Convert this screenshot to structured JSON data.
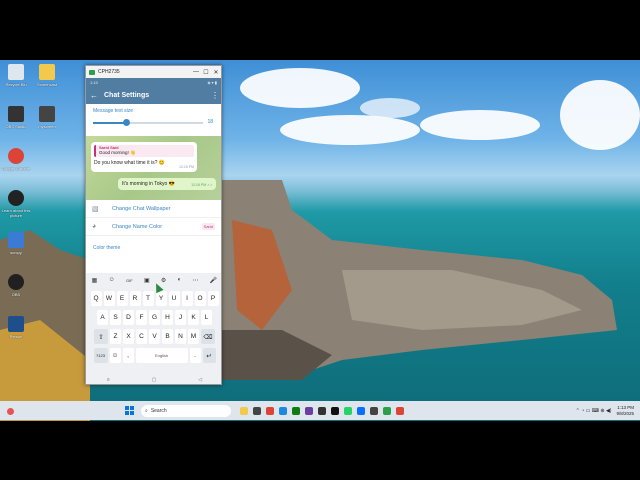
{
  "phone_window": {
    "title": "CPH2735",
    "min_label": "—",
    "max_label": "☐",
    "close_label": "✕"
  },
  "status_bar": {
    "time": "1:13",
    "right": "◈ ▾ ▮"
  },
  "app_bar": {
    "back_label": "←",
    "title": "Chat Settings",
    "menu_label": "⋮"
  },
  "message_size": {
    "label": "Message text size",
    "value": "18",
    "fraction": 0.3
  },
  "chat_preview": {
    "incoming": {
      "reply_name": "Sarid Said",
      "reply_text": "Good morning! 👋",
      "text": "Do you know what time it is? 😊",
      "time": "12:15 PM"
    },
    "outgoing": {
      "text": "It's morning in Tokyo 😎",
      "time": "12:16 PM ✓✓"
    }
  },
  "settings_rows": [
    {
      "label": "Change Chat Wallpaper",
      "icon": "wallpaper-icon",
      "badge": ""
    },
    {
      "label": "Change Name Color",
      "icon": "palette-icon",
      "badge": "Sarid"
    }
  ],
  "color_theme_label": "Color theme",
  "keyboard": {
    "tools": [
      "▦",
      "☺",
      "GIF",
      "▣",
      "⚙",
      "◐",
      "⋯",
      "🎤"
    ],
    "row1": [
      "Q",
      "W",
      "E",
      "R",
      "T",
      "Y",
      "U",
      "I",
      "O",
      "P"
    ],
    "row2": [
      "A",
      "S",
      "D",
      "F",
      "G",
      "H",
      "J",
      "K",
      "L"
    ],
    "row3": [
      "Z",
      "X",
      "C",
      "V",
      "B",
      "N",
      "M"
    ],
    "shift": "⇧",
    "backspace": "⌫",
    "sym": "?123",
    "emoji": "☺",
    "comma": ",",
    "space": "English",
    "period": ".",
    "enter": "↵"
  },
  "nav": {
    "recent": "≡",
    "home": "▢",
    "back": "◁"
  },
  "desktop_icons": [
    {
      "label": "Recycle Bin",
      "icon": "recycle-bin-icon",
      "color": "#dfe7ee"
    },
    {
      "label": "Screencast",
      "icon": "folder-icon",
      "color": "#f2c94c"
    },
    {
      "label": "OBS Studio",
      "icon": "app-icon",
      "color": "#333333"
    },
    {
      "label": "myscreen",
      "icon": "film-icon",
      "color": "#444444"
    },
    {
      "label": "Google Chrome",
      "icon": "chrome-icon",
      "color": "#db4437"
    },
    {
      "label": "Learn about this picture",
      "icon": "info-icon",
      "color": "#222222"
    },
    {
      "label": "scrcpy",
      "icon": "scrcpy-icon",
      "color": "#3a7bd5"
    },
    {
      "label": "OBS",
      "icon": "obs-icon",
      "color": "#202020"
    },
    {
      "label": "Person",
      "icon": "person-icon",
      "color": "#1f4e8c"
    }
  ],
  "taskbar": {
    "search_placeholder": "Search",
    "apps": [
      {
        "icon": "file-explorer-icon",
        "color": "#f2c94c"
      },
      {
        "icon": "browser-icon",
        "color": "#444"
      },
      {
        "icon": "chrome-icon",
        "color": "#db4437"
      },
      {
        "icon": "store-icon",
        "color": "#1e88e5"
      },
      {
        "icon": "xbox-icon",
        "color": "#107c10"
      },
      {
        "icon": "app-icon",
        "color": "#6b3fa0"
      },
      {
        "icon": "terminal-icon",
        "color": "#333"
      },
      {
        "icon": "capcut-icon",
        "color": "#111"
      },
      {
        "icon": "whatsapp-icon",
        "color": "#25d366"
      },
      {
        "icon": "app-icon",
        "color": "#0d6efd"
      },
      {
        "icon": "app-icon",
        "color": "#444"
      },
      {
        "icon": "app-icon",
        "color": "#2aa04a"
      },
      {
        "icon": "chrome-icon",
        "color": "#db4437"
      }
    ],
    "tray": "⌃  ◔  ▭  ⌨  ⊕  ◀)",
    "time": "1:13 PM",
    "date": "9/8/2025"
  }
}
